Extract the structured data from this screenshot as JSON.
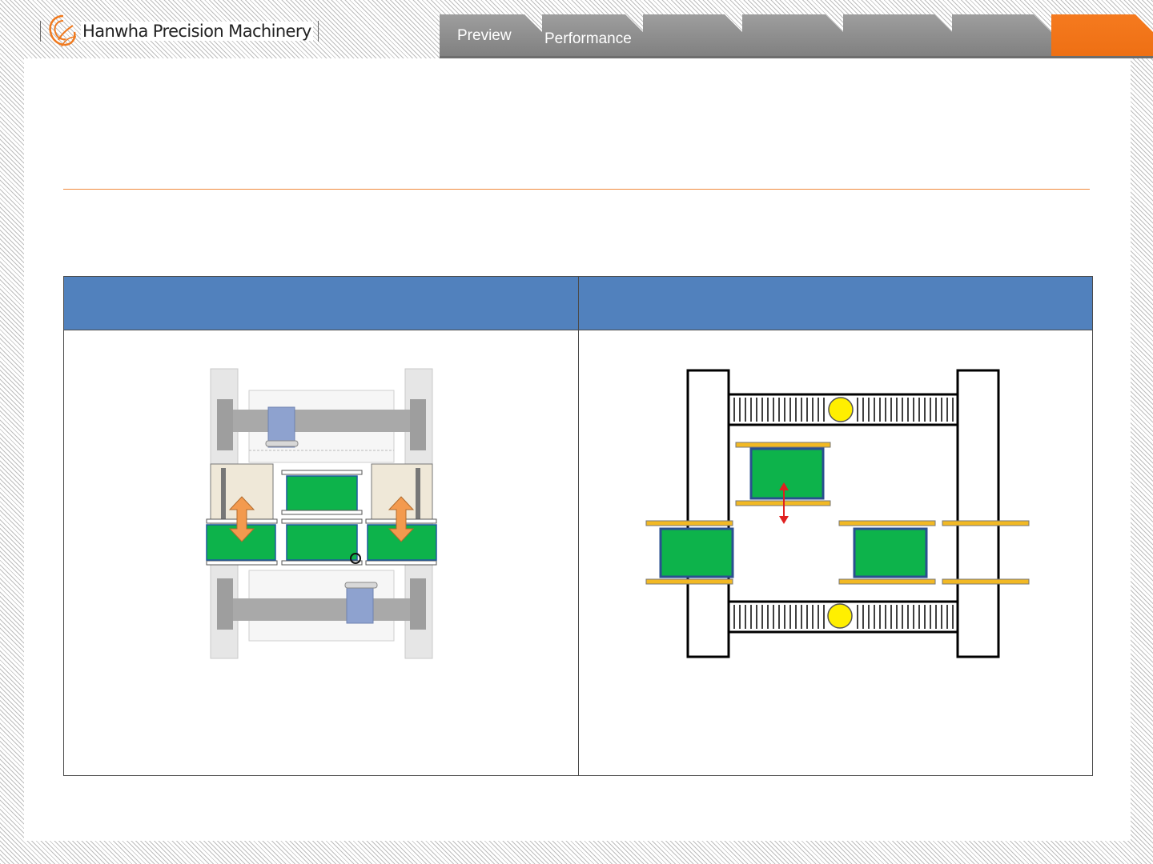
{
  "header": {
    "brand_name": "Hanwha Precision Machinery",
    "tabs": [
      {
        "label": "Preview",
        "active": false
      },
      {
        "label": "Performance",
        "active": false
      },
      {
        "label": "",
        "active": false
      },
      {
        "label": "",
        "active": false
      },
      {
        "label": "",
        "active": false
      },
      {
        "label": "",
        "active": false
      },
      {
        "label": "",
        "active": true
      }
    ]
  },
  "colors": {
    "accent_orange": "#f07a1f",
    "tab_gray": "#8f8f8f",
    "table_header_blue": "#5181bd",
    "pcb_green": "#0db34b",
    "rail_yellow": "#f2b924",
    "indicator_yellow": "#ffef00",
    "arrow_red": "#e02020",
    "arrow_orange": "#f39a4e"
  },
  "table": {
    "headers": [
      "",
      ""
    ],
    "diagrams": [
      {
        "name": "shuttle-conveyor-diagram",
        "description_icons": [
          "pcb-board-icon",
          "up-down-arrow-icon"
        ]
      },
      {
        "name": "dual-lane-conveyor-diagram",
        "description_icons": [
          "pcb-board-icon",
          "up-down-arrow-icon"
        ]
      }
    ]
  }
}
